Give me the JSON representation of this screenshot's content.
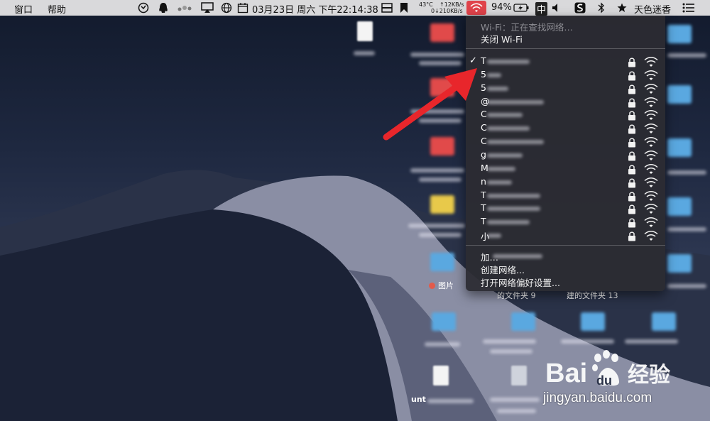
{
  "menubar": {
    "menus": [
      "窗口",
      "帮助"
    ],
    "temperature": "43°C",
    "net_up": "↑12KB/s",
    "net_down": "0↓210KB/s",
    "datetime": "03月23日 周六 下午22:14:38",
    "battery_percent": "94%",
    "input_method": "中",
    "user_name": "天色迷香",
    "icons": [
      "app-icon",
      "qq-icon",
      "dots-icon",
      "airplay-icon",
      "globe-icon",
      "calendar-icon",
      "window-icon",
      "bookmark-icon",
      "wifi-icon",
      "battery-icon",
      "speaker-icon",
      "sogou-icon",
      "bluetooth-icon",
      "star-icon",
      "list-icon"
    ]
  },
  "wifi_menu": {
    "status": "Wi-Fi：正在查找网络…",
    "toggle_label": "关闭 Wi-Fi",
    "networks": [
      {
        "first_char": "T",
        "connected": true
      },
      {
        "first_char": "5",
        "connected": false
      },
      {
        "first_char": "5",
        "connected": false
      },
      {
        "first_char": "@",
        "connected": false
      },
      {
        "first_char": "C",
        "connected": false
      },
      {
        "first_char": "C",
        "connected": false
      },
      {
        "first_char": "C",
        "connected": false
      },
      {
        "first_char": "g",
        "connected": false
      },
      {
        "first_char": "M",
        "connected": false
      },
      {
        "first_char": "n",
        "connected": false
      },
      {
        "first_char": "T",
        "connected": false
      },
      {
        "first_char": "T",
        "connected": false
      },
      {
        "first_char": "T",
        "connected": false
      },
      {
        "first_char": "小",
        "connected": false
      }
    ],
    "join_other": "加…",
    "create_network": "创建网络...",
    "open_prefs": "打开网络偏好设置..."
  },
  "desktop": {
    "labels": {
      "pictures": "图片",
      "folder9": "的文件夹 9",
      "folder13": "建的文件夹 13",
      "untitled": "unt"
    }
  },
  "watermark": {
    "brand": "Bai du 经验",
    "domain": "jingyan.baidu.com"
  },
  "colors": {
    "menubar_bg": "#d9d9db",
    "wifi_highlight": "#e0434b",
    "dropdown_bg": "#2c2c32",
    "arrow": "#e8262b"
  }
}
